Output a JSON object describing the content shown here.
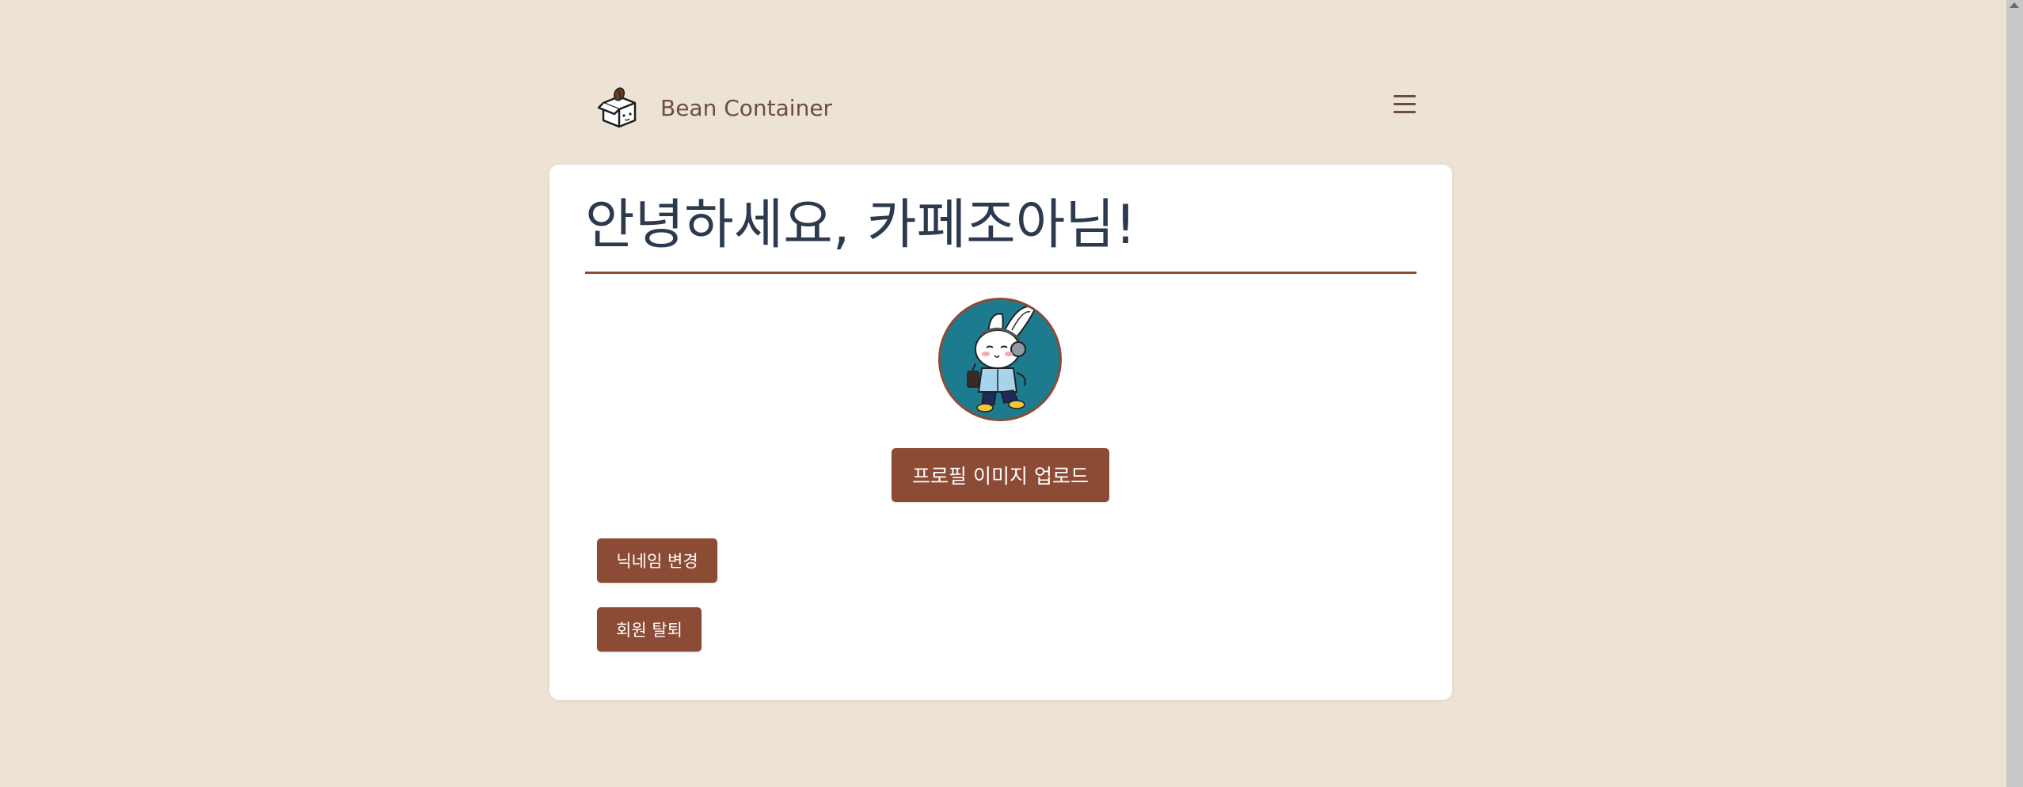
{
  "header": {
    "brand_name": "Bean Container",
    "logo_icon": "bean-box-icon",
    "menu_icon": "hamburger-menu-icon"
  },
  "profile": {
    "greeting": "안녕하세요, 카페조아님!",
    "avatar_icon": "rabbit-avatar-image",
    "upload_label": "프로필 이미지 업로드",
    "change_nickname_label": "닉네임 변경",
    "withdraw_label": "회원 탈퇴"
  },
  "colors": {
    "background": "#ede3d5",
    "accent": "#8b4b34",
    "heading": "#2b3a4d",
    "brand_text": "#6a4e43",
    "avatar_bg": "#1d7b8f"
  }
}
